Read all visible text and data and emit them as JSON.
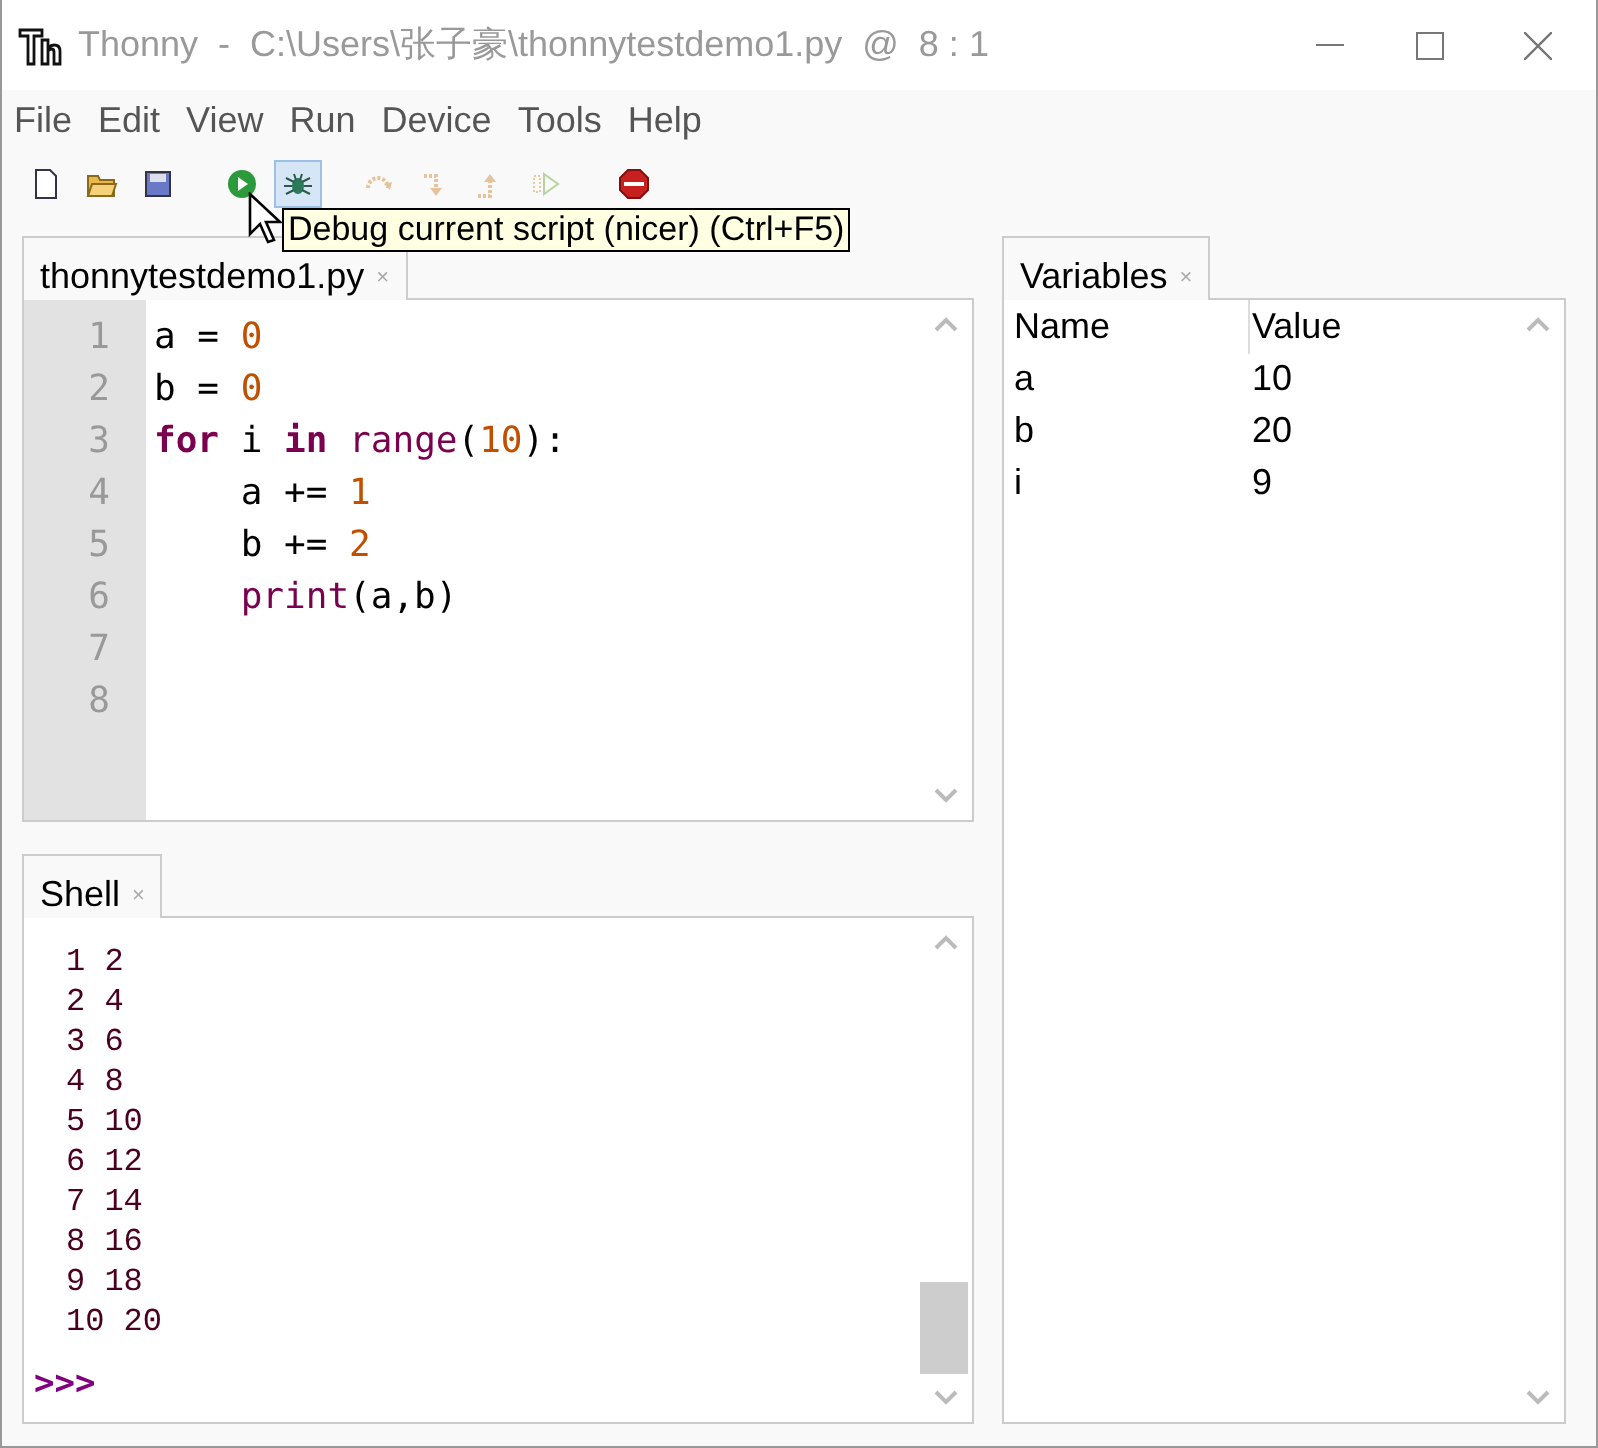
{
  "window": {
    "title": "Thonny  -  C:\\Users\\张子豪\\thonnytestdemo1.py  @  8 : 1"
  },
  "menu": [
    "File",
    "Edit",
    "View",
    "Run",
    "Device",
    "Tools",
    "Help"
  ],
  "toolbar": [
    {
      "kind": "new",
      "disabled": false,
      "highlighted": false
    },
    {
      "kind": "open",
      "disabled": false,
      "highlighted": false
    },
    {
      "kind": "save",
      "disabled": false,
      "highlighted": false
    },
    {
      "kind": "run",
      "disabled": false,
      "highlighted": false
    },
    {
      "kind": "debug",
      "disabled": false,
      "highlighted": true
    },
    {
      "kind": "step-over",
      "disabled": true,
      "highlighted": false
    },
    {
      "kind": "step-into",
      "disabled": true,
      "highlighted": false
    },
    {
      "kind": "step-out",
      "disabled": true,
      "highlighted": false
    },
    {
      "kind": "resume",
      "disabled": true,
      "highlighted": false
    },
    {
      "kind": "stop",
      "disabled": false,
      "highlighted": false
    }
  ],
  "tooltip": "Debug current script (nicer) (Ctrl+F5)",
  "editor": {
    "tab": "thonnytestdemo1.py",
    "close": "×",
    "line_numbers": [
      "1",
      "2",
      "3",
      "4",
      "5",
      "6",
      "7",
      "8"
    ],
    "lines": [
      [
        {
          "text": "a = ",
          "kind": "plain"
        },
        {
          "text": "0",
          "kind": "number"
        }
      ],
      [
        {
          "text": "b = ",
          "kind": "plain"
        },
        {
          "text": "0",
          "kind": "number"
        }
      ],
      [
        {
          "text": "for",
          "kind": "keyword"
        },
        {
          "text": " i ",
          "kind": "plain"
        },
        {
          "text": "in",
          "kind": "keyword"
        },
        {
          "text": " range",
          "kind": "builtin"
        },
        {
          "text": "(",
          "kind": "plain"
        },
        {
          "text": "10",
          "kind": "number"
        },
        {
          "text": "):",
          "kind": "plain"
        }
      ],
      [
        {
          "text": "    a += ",
          "kind": "plain"
        },
        {
          "text": "1",
          "kind": "number"
        }
      ],
      [
        {
          "text": "    b += ",
          "kind": "plain"
        },
        {
          "text": "2",
          "kind": "number"
        }
      ],
      [
        {
          "text": "    print",
          "kind": "builtin"
        },
        {
          "text": "(a,b)",
          "kind": "plain"
        }
      ]
    ]
  },
  "shell": {
    "tab": "Shell",
    "close": "×",
    "output": [
      "1 2",
      "2 4",
      "3 6",
      "4 8",
      "5 10",
      "6 12",
      "7 14",
      "8 16",
      "9 18",
      "10 20"
    ],
    "prompt": ">>>"
  },
  "variables": {
    "tab": "Variables",
    "close": "×",
    "columns": [
      "Name",
      "Value"
    ],
    "rows": [
      [
        "a",
        "10"
      ],
      [
        "b",
        "20"
      ],
      [
        "i",
        "9"
      ]
    ]
  }
}
